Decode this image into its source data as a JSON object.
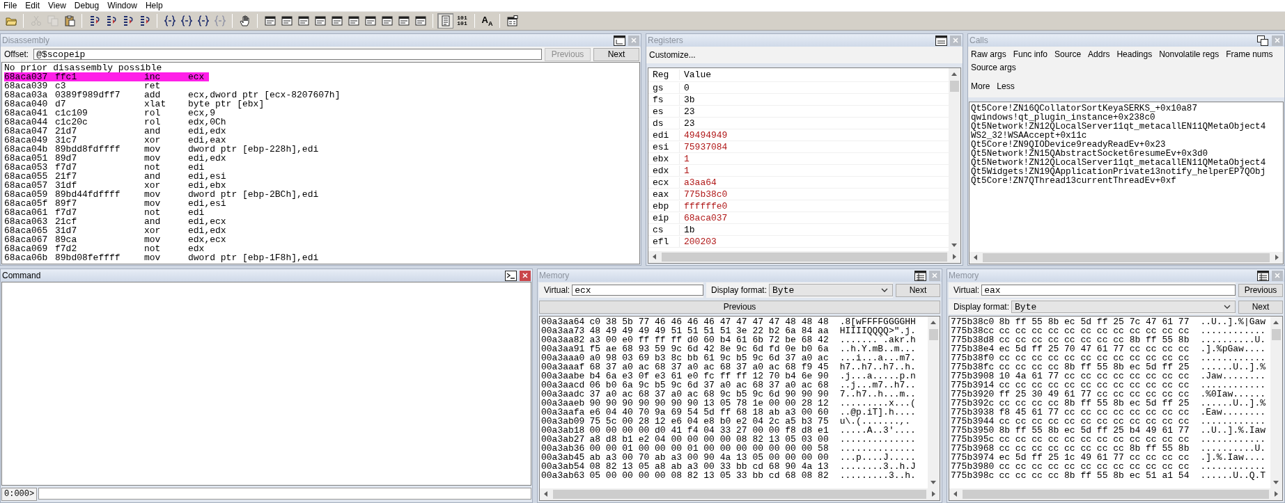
{
  "menu": [
    {
      "label": "File"
    },
    {
      "label": "Edit"
    },
    {
      "label": "View"
    },
    {
      "label": "Debug"
    },
    {
      "label": "Window"
    },
    {
      "label": "Help"
    }
  ],
  "toolbar": [
    {
      "kind": "open",
      "disabled": false,
      "pressed": false
    },
    {
      "kind": "separator"
    },
    {
      "kind": "cut",
      "disabled": true,
      "pressed": false
    },
    {
      "kind": "copy",
      "disabled": true,
      "pressed": false
    },
    {
      "kind": "paste",
      "disabled": false,
      "pressed": false
    },
    {
      "kind": "separator"
    },
    {
      "kind": "step",
      "disabled": false,
      "pressed": false
    },
    {
      "kind": "step",
      "disabled": false,
      "pressed": false
    },
    {
      "kind": "step",
      "disabled": false,
      "pressed": false
    },
    {
      "kind": "step",
      "disabled": false,
      "pressed": false
    },
    {
      "kind": "separator"
    },
    {
      "kind": "brace",
      "disabled": false,
      "pressed": false
    },
    {
      "kind": "brace",
      "disabled": false,
      "pressed": false
    },
    {
      "kind": "brace",
      "disabled": false,
      "pressed": false
    },
    {
      "kind": "brace",
      "disabled": true,
      "pressed": false
    },
    {
      "kind": "separator"
    },
    {
      "kind": "hand",
      "disabled": false,
      "pressed": false
    },
    {
      "kind": "separator"
    },
    {
      "kind": "window",
      "disabled": false,
      "pressed": false
    },
    {
      "kind": "window",
      "disabled": false,
      "pressed": false
    },
    {
      "kind": "window",
      "disabled": false,
      "pressed": false
    },
    {
      "kind": "window",
      "disabled": false,
      "pressed": false
    },
    {
      "kind": "window",
      "disabled": false,
      "pressed": false
    },
    {
      "kind": "window",
      "disabled": false,
      "pressed": false
    },
    {
      "kind": "window",
      "disabled": false,
      "pressed": false
    },
    {
      "kind": "window",
      "disabled": false,
      "pressed": false
    },
    {
      "kind": "window",
      "disabled": false,
      "pressed": false
    },
    {
      "kind": "window",
      "disabled": false,
      "pressed": false
    },
    {
      "kind": "separator"
    },
    {
      "kind": "source",
      "disabled": false,
      "pressed": true
    },
    {
      "kind": "binary",
      "label": "101 101",
      "disabled": false,
      "pressed": false
    },
    {
      "kind": "separator"
    },
    {
      "kind": "font",
      "label": "A$_{A}$",
      "disabled": false,
      "pressed": false
    },
    {
      "kind": "separator"
    },
    {
      "kind": "options",
      "disabled": false,
      "pressed": false
    }
  ],
  "disassembly": {
    "title": "Disassembly",
    "active": false,
    "offset_label": "Offset:",
    "offset": "@$scopeip",
    "previous": {
      "label": "Previous",
      "disabled": true
    },
    "next": {
      "label": "Next",
      "disabled": false
    },
    "lines": [
      {
        "kind": "message",
        "text": "No prior disassembly possible"
      },
      {
        "kind": "instruction",
        "address": "68aca037",
        "bytes": "ffc1",
        "mnemonic": "inc",
        "operands": "ecx",
        "current": true
      },
      {
        "kind": "instruction",
        "address": "68aca039",
        "bytes": "c3",
        "mnemonic": "ret",
        "current": false
      },
      {
        "kind": "instruction",
        "address": "68aca03a",
        "bytes": "0389f989dff7",
        "mnemonic": "add",
        "operands": "ecx,dword ptr [ecx-8207607h]",
        "current": false
      },
      {
        "kind": "instruction",
        "address": "68aca040",
        "bytes": "d7",
        "mnemonic": "xlat",
        "operands": "byte ptr [ebx]",
        "current": false
      },
      {
        "kind": "instruction",
        "address": "68aca041",
        "bytes": "c1c109",
        "mnemonic": "rol",
        "operands": "ecx,9",
        "current": false
      },
      {
        "kind": "instruction",
        "address": "68aca044",
        "bytes": "c1c20c",
        "mnemonic": "rol",
        "operands": "edx,0Ch",
        "current": false
      },
      {
        "kind": "instruction",
        "address": "68aca047",
        "bytes": "21d7",
        "mnemonic": "and",
        "operands": "edi,edx",
        "current": false
      },
      {
        "kind": "instruction",
        "address": "68aca049",
        "bytes": "31c7",
        "mnemonic": "xor",
        "operands": "edi,eax",
        "current": false
      },
      {
        "kind": "instruction",
        "address": "68aca04b",
        "bytes": "89bdd8fdffff",
        "mnemonic": "mov",
        "operands": "dword ptr [ebp-228h],edi",
        "current": false
      },
      {
        "kind": "instruction",
        "address": "68aca051",
        "bytes": "89d7",
        "mnemonic": "mov",
        "operands": "edi,edx",
        "current": false
      },
      {
        "kind": "instruction",
        "address": "68aca053",
        "bytes": "f7d7",
        "mnemonic": "not",
        "operands": "edi",
        "current": false
      },
      {
        "kind": "instruction",
        "address": "68aca055",
        "bytes": "21f7",
        "mnemonic": "and",
        "operands": "edi,esi",
        "current": false
      },
      {
        "kind": "instruction",
        "address": "68aca057",
        "bytes": "31df",
        "mnemonic": "xor",
        "operands": "edi,ebx",
        "current": false
      },
      {
        "kind": "instruction",
        "address": "68aca059",
        "bytes": "89bd44fdffff",
        "mnemonic": "mov",
        "operands": "dword ptr [ebp-2BCh],edi",
        "current": false
      },
      {
        "kind": "instruction",
        "address": "68aca05f",
        "bytes": "89f7",
        "mnemonic": "mov",
        "operands": "edi,esi",
        "current": false
      },
      {
        "kind": "instruction",
        "address": "68aca061",
        "bytes": "f7d7",
        "mnemonic": "not",
        "operands": "edi",
        "current": false
      },
      {
        "kind": "instruction",
        "address": "68aca063",
        "bytes": "21cf",
        "mnemonic": "and",
        "operands": "edi,ecx",
        "current": false
      },
      {
        "kind": "instruction",
        "address": "68aca065",
        "bytes": "31d7",
        "mnemonic": "xor",
        "operands": "edi,edx",
        "current": false
      },
      {
        "kind": "instruction",
        "address": "68aca067",
        "bytes": "89ca",
        "mnemonic": "mov",
        "operands": "edx,ecx",
        "current": false
      },
      {
        "kind": "instruction",
        "address": "68aca069",
        "bytes": "f7d2",
        "mnemonic": "not",
        "operands": "edx",
        "current": false
      },
      {
        "kind": "instruction",
        "address": "68aca06b",
        "bytes": "89bd08feffff",
        "mnemonic": "mov",
        "operands": "dword ptr [ebp-1F8h],edi",
        "current": false
      }
    ]
  },
  "registers": {
    "title": "Registers",
    "active": false,
    "customize": "Customize...",
    "columns": [
      "Reg",
      "Value"
    ],
    "rows": [
      {
        "name": "gs",
        "value": "0",
        "changed": false
      },
      {
        "name": "fs",
        "value": "3b",
        "changed": false
      },
      {
        "name": "es",
        "value": "23",
        "changed": false
      },
      {
        "name": "ds",
        "value": "23",
        "changed": false
      },
      {
        "name": "edi",
        "value": "49494949",
        "changed": true
      },
      {
        "name": "esi",
        "value": "75937084",
        "changed": true
      },
      {
        "name": "ebx",
        "value": "1",
        "changed": true
      },
      {
        "name": "edx",
        "value": "1",
        "changed": true
      },
      {
        "name": "ecx",
        "value": "a3aa64",
        "changed": true
      },
      {
        "name": "eax",
        "value": "775b38c0",
        "changed": true
      },
      {
        "name": "ebp",
        "value": "ffffffe0",
        "changed": true
      },
      {
        "name": "eip",
        "value": "68aca037",
        "changed": true
      },
      {
        "name": "cs",
        "value": "1b",
        "changed": false
      },
      {
        "name": "efl",
        "value": "200203",
        "changed": true
      }
    ]
  },
  "calls": {
    "title": "Calls",
    "active": false,
    "options": [
      "Raw args",
      "Func info",
      "Source",
      "Addrs",
      "Headings",
      "Nonvolatile regs",
      "Frame nums",
      "Source args"
    ],
    "actions": [
      "More",
      "Less"
    ],
    "frames": [
      "Qt5Core!ZN16QCollatorSortKeyaSERKS_+0x10a87",
      "qwindows!qt_plugin_instance+0x238c0",
      "Qt5Network!ZN12QLocalServer11qt_metacallEN11QMetaObject4",
      "WS2_32!WSAAccept+0x11c",
      "Qt5Core!ZN9QIODevice9readyReadEv+0x23",
      "Qt5Network!ZN15QAbstractSocket6resumeEv+0x3d0",
      "Qt5Network!ZN12QLocalServer11qt_metacallEN11QMetaObject4",
      "Qt5Widgets!ZN19QApplicationPrivate13notify_helperEP7QObj",
      "Qt5Core!ZN7QThread13currentThreadEv+0xf"
    ]
  },
  "command": {
    "title": "Command",
    "active": true,
    "prompt": "0:000>"
  },
  "memory": [
    {
      "title": "Memory",
      "active": false,
      "kind": "wide",
      "virtual_label": "Virtual:",
      "virtual": "ecx",
      "format_label": "Display format:",
      "format": "Byte",
      "previous": "Previous",
      "next": "Next",
      "rows": [
        {
          "address": "00a3aa64",
          "bytes": "c0 38 5b 77 46 46 46 46 47 47 47 47 48 48 48",
          "ascii": ".8[wFFFFGGGGHH"
        },
        {
          "address": "00a3aa73",
          "bytes": "48 49 49 49 49 51 51 51 51 3e 22 b2 6a 84 aa",
          "ascii": "HIIIIQQQQ>\".j."
        },
        {
          "address": "00a3aa82",
          "bytes": "a3 00 e0 ff ff ff d0 60 b4 61 6b 72 be 68 42",
          "ascii": ".......`.akr.h"
        },
        {
          "address": "00a3aa91",
          "bytes": "f5 ae 68 93 59 9c 6d 42 8e 9c 6d fd 0e b0 6a",
          "ascii": "..h.Y.mB..m..."
        },
        {
          "address": "00a3aaa0",
          "bytes": "a0 98 03 69 b3 8c bb 61 9c b5 9c 6d 37 a0 ac",
          "ascii": "...i...a...m7."
        },
        {
          "address": "00a3aaaf",
          "bytes": "68 37 a0 ac 68 37 a0 ac 68 37 a0 ac 68 f9 45",
          "ascii": "h7..h7..h7..h."
        },
        {
          "address": "00a3aabe",
          "bytes": "b4 6a e3 0f e3 61 e0 fc ff ff 12 70 b4 6e 90",
          "ascii": ".j...a.....p.n"
        },
        {
          "address": "00a3aacd",
          "bytes": "06 b0 6a 9c b5 9c 6d 37 a0 ac 68 37 a0 ac 68",
          "ascii": "..j...m7..h7.."
        },
        {
          "address": "00a3aadc",
          "bytes": "37 a0 ac 68 37 a0 ac 68 9c b5 9c 6d 90 90 90",
          "ascii": "7..h7..h...m.."
        },
        {
          "address": "00a3aaeb",
          "bytes": "90 90 90 90 90 90 90 13 05 78 1e 00 00 28 12",
          "ascii": ".........x...("
        },
        {
          "address": "00a3aafa",
          "bytes": "e6 04 40 70 9a 69 54 5d ff 68 18 ab a3 00 60",
          "ascii": "..@p.iT].h...."
        },
        {
          "address": "00a3ab09",
          "bytes": "75 5c 00 28 12 e6 04 e8 b0 e2 04 2c a5 b3 75",
          "ascii": "u\\.(.......,."
        },
        {
          "address": "00a3ab18",
          "bytes": "00 00 00 00 d0 41 f4 04 33 27 00 00 f8 d8 e1",
          "ascii": ".....A..3'...."
        },
        {
          "address": "00a3ab27",
          "bytes": "a8 d8 b1 e2 04 00 00 00 00 08 82 13 05 03 00",
          "ascii": ".............."
        },
        {
          "address": "00a3ab36",
          "bytes": "00 00 01 00 00 00 01 00 00 00 00 00 00 00 58",
          "ascii": ".............."
        },
        {
          "address": "00a3ab45",
          "bytes": "ab a3 00 70 ab a3 00 90 4a 13 05 00 00 00 00",
          "ascii": "...p....J....."
        },
        {
          "address": "00a3ab54",
          "bytes": "08 82 13 05 a8 ab a3 00 33 bb cd 68 90 4a 13",
          "ascii": "........3..h.J"
        },
        {
          "address": "00a3ab63",
          "bytes": "05 00 00 00 00 08 82 13 05 33 bb cd 68 08 82",
          "ascii": ".........3..h."
        }
      ]
    },
    {
      "title": "Memory",
      "active": false,
      "kind": "stacked",
      "virtual_label": "Virtual:",
      "virtual": "eax",
      "format_label": "Display format:",
      "format": "Byte",
      "previous": "Previous",
      "next": "Next",
      "rows": [
        {
          "address": "775b38c0",
          "bytes": "8b ff 55 8b ec 5d ff 25 7c 47 61 77",
          "ascii": "..U..].%|Gaw"
        },
        {
          "address": "775b38cc",
          "bytes": "cc cc cc cc cc cc cc cc cc cc cc cc",
          "ascii": "............"
        },
        {
          "address": "775b38d8",
          "bytes": "cc cc cc cc cc cc cc cc 8b ff 55 8b",
          "ascii": "..........U."
        },
        {
          "address": "775b38e4",
          "bytes": "ec 5d ff 25 70 47 61 77 cc cc cc cc",
          "ascii": ".].%pGaw...."
        },
        {
          "address": "775b38f0",
          "bytes": "cc cc cc cc cc cc cc cc cc cc cc cc",
          "ascii": "............"
        },
        {
          "address": "775b38fc",
          "bytes": "cc cc cc cc 8b ff 55 8b ec 5d ff 25",
          "ascii": "......U..].%"
        },
        {
          "address": "775b3908",
          "bytes": "10 4a 61 77 cc cc cc cc cc cc cc cc",
          "ascii": ".Jaw........"
        },
        {
          "address": "775b3914",
          "bytes": "cc cc cc cc cc cc cc cc cc cc cc cc",
          "ascii": "............"
        },
        {
          "address": "775b3920",
          "bytes": "ff 25 30 49 61 77 cc cc cc cc cc cc",
          "ascii": ".%0Iaw......"
        },
        {
          "address": "775b392c",
          "bytes": "cc cc cc cc 8b ff 55 8b ec 5d ff 25",
          "ascii": "......U..].%"
        },
        {
          "address": "775b3938",
          "bytes": "f8 45 61 77 cc cc cc cc cc cc cc cc",
          "ascii": ".Eaw........"
        },
        {
          "address": "775b3944",
          "bytes": "cc cc cc cc cc cc cc cc cc cc cc cc",
          "ascii": "............"
        },
        {
          "address": "775b3950",
          "bytes": "8b ff 55 8b ec 5d ff 25 b4 49 61 77",
          "ascii": "..U..].%.Iaw"
        },
        {
          "address": "775b395c",
          "bytes": "cc cc cc cc cc cc cc cc cc cc cc cc",
          "ascii": "............"
        },
        {
          "address": "775b3968",
          "bytes": "cc cc cc cc cc cc cc cc 8b ff 55 8b",
          "ascii": "..........U."
        },
        {
          "address": "775b3974",
          "bytes": "ec 5d ff 25 1c 49 61 77 cc cc cc cc",
          "ascii": ".].%.Iaw...."
        },
        {
          "address": "775b3980",
          "bytes": "cc cc cc cc cc cc cc cc cc cc cc cc",
          "ascii": "............"
        },
        {
          "address": "775b398c",
          "bytes": "cc cc cc cc 8b ff 55 8b ec 51 a1 54",
          "ascii": "......U..Q.T"
        }
      ]
    }
  ]
}
